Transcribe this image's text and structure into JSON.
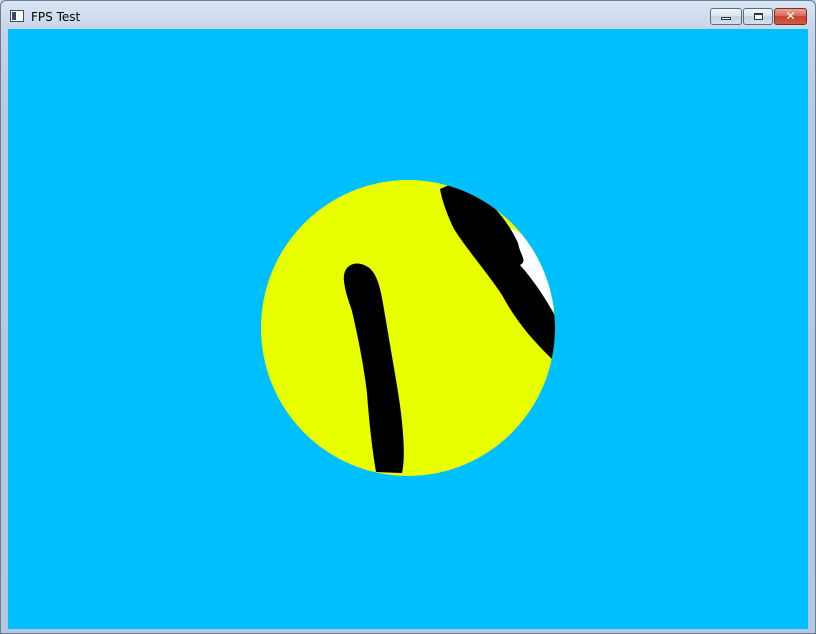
{
  "window": {
    "title": "FPS Test",
    "icon": "application-window-icon",
    "controls": {
      "minimize_icon": "minimize-icon",
      "maximize_icon": "maximize-icon",
      "close_icon": "close-icon",
      "close_glyph": "✕"
    }
  },
  "scene": {
    "background_color": "#00bfff",
    "ball": {
      "color": "#e8ff00",
      "stripe_color": "#000000",
      "highlight_color": "#ffffff"
    }
  },
  "colors": {
    "titlebar": "#c6d5e8",
    "close_button": "#c6412b"
  }
}
